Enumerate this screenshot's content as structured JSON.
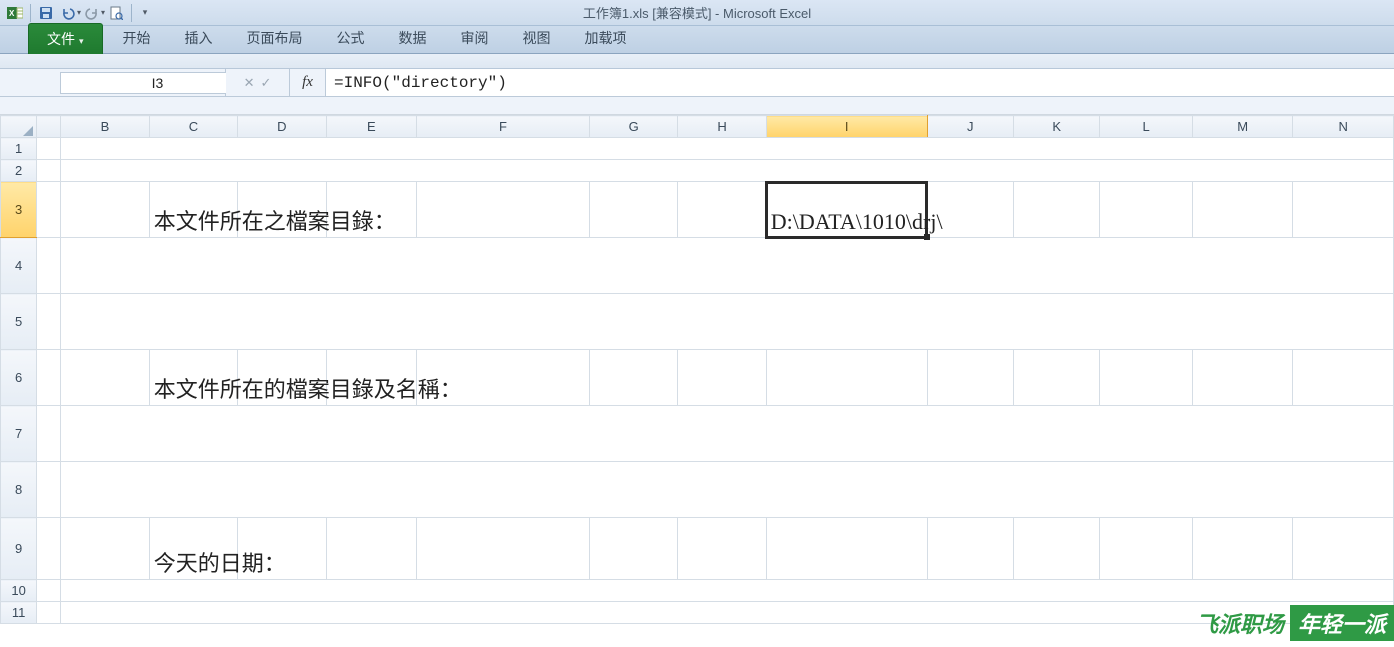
{
  "window": {
    "title_full": "工作簿1.xls [兼容模式] - Microsoft Excel"
  },
  "qat": {
    "icons": {
      "excel": "excel-icon",
      "save": "save-icon",
      "undo": "undo-icon",
      "redo": "redo-icon",
      "print": "print-preview-icon",
      "customize": "customize-qat-icon"
    }
  },
  "tabs": {
    "file": "文件",
    "home": "开始",
    "insert": "插入",
    "page_layout": "页面布局",
    "formulas": "公式",
    "data": "数据",
    "review": "审阅",
    "view": "视图",
    "addins": "加载项"
  },
  "namebox": {
    "value": "I3"
  },
  "formula_bar": {
    "fx_label": "fx",
    "value": "=INFO(\"directory\")"
  },
  "columns": [
    "B",
    "C",
    "D",
    "E",
    "F",
    "G",
    "H",
    "I",
    "J",
    "K",
    "L",
    "M",
    "N"
  ],
  "active_column": "I",
  "rows": [
    "1",
    "2",
    "3",
    "4",
    "5",
    "6",
    "7",
    "8",
    "9",
    "10",
    "11"
  ],
  "active_row": "3",
  "cells": {
    "C3": "本文件所在之檔案目錄：",
    "I3": "D:\\DATA\\1010\\drj\\",
    "C6": "本文件所在的檔案目錄及名稱：",
    "C9": "今天的日期："
  },
  "watermark": {
    "left": "飞派职场",
    "right": "年轻一派"
  }
}
